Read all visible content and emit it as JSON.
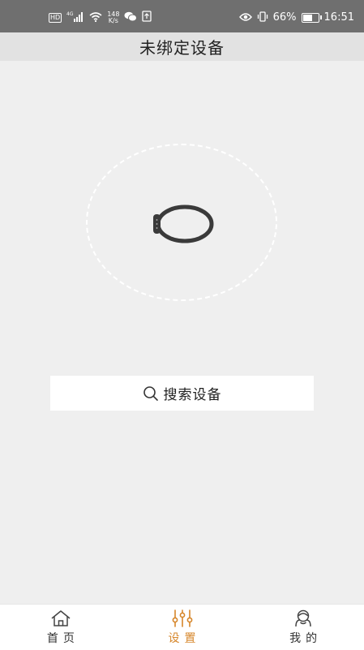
{
  "status_bar": {
    "hd": "HD",
    "network": "4G",
    "speed_value": "148",
    "speed_unit": "K/s",
    "battery_percent": "66%",
    "battery_level": 0.66,
    "time": "16:51"
  },
  "header": {
    "title": "未绑定设备"
  },
  "search": {
    "label": "搜索设备"
  },
  "bottom_nav": {
    "active_color": "#d6862a",
    "items": [
      {
        "label": "首页",
        "icon": "home-icon",
        "active": false
      },
      {
        "label": "设置",
        "icon": "sliders-icon",
        "active": true
      },
      {
        "label": "我的",
        "icon": "profile-icon",
        "active": false
      }
    ]
  }
}
